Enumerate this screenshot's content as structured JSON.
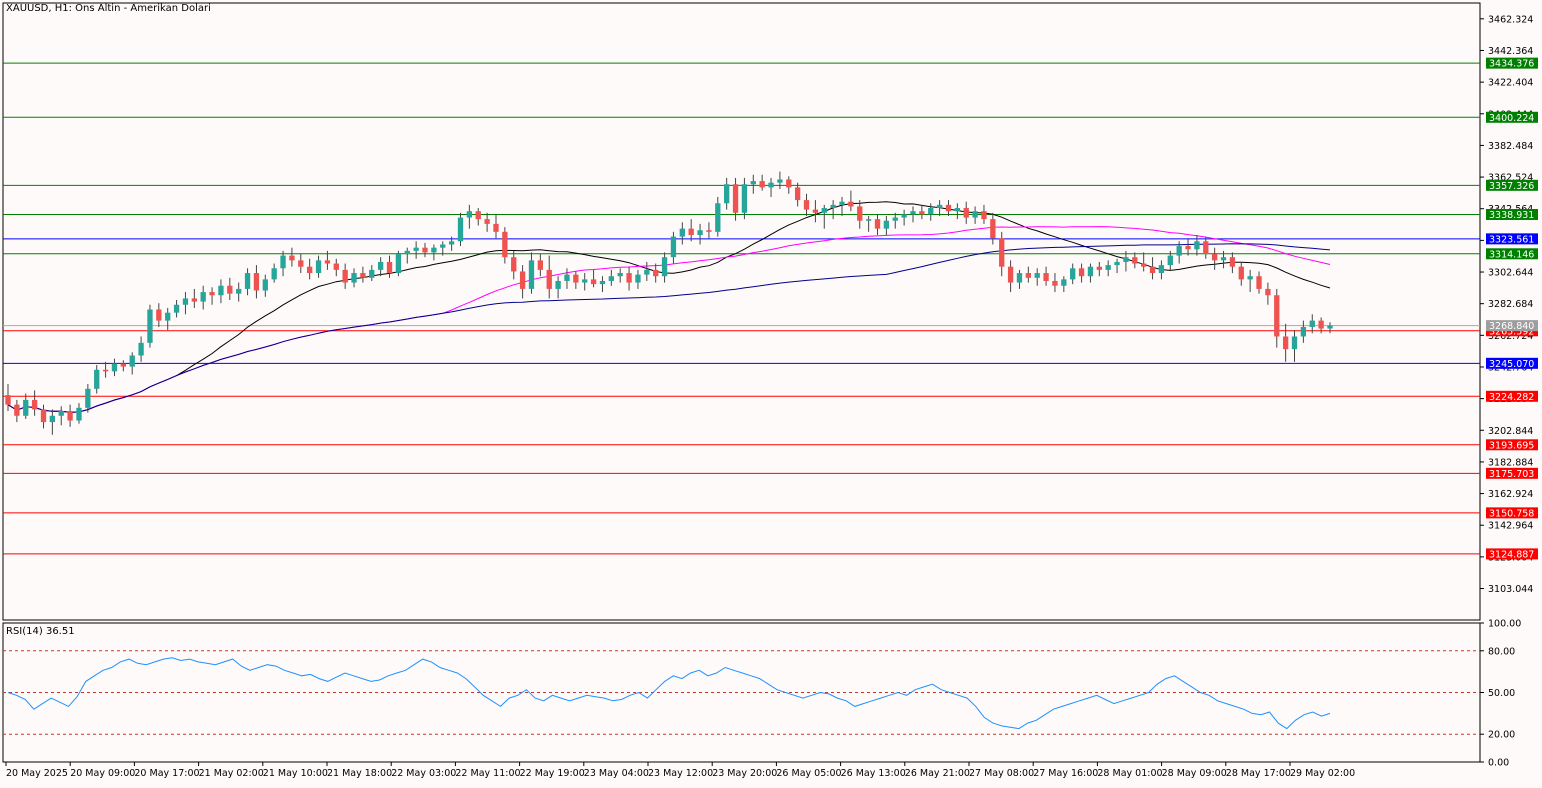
{
  "title": "XAUUSD, H1:  Ons Altin - Amerikan Dolari",
  "rsi_title": "RSI(14) 36.51",
  "chart_data": [
    {
      "type": "candlestick",
      "symbol": "XAUUSD",
      "timeframe": "H1",
      "title": "XAUUSD, H1:  Ons Altin - Amerikan Dolari",
      "ylim": [
        3083.2,
        3472.3
      ],
      "y_ticks": [
        "3462.324",
        "3442.364",
        "3422.404",
        "3402.444",
        "3382.484",
        "3362.524",
        "3342.564",
        "3322.604",
        "3302.644",
        "3282.684",
        "3262.724",
        "3242.764",
        "3222.804",
        "3202.844",
        "3182.884",
        "3162.924",
        "3142.964",
        "3123.004",
        "3103.044"
      ],
      "x_ticks": [
        "20 May 2025",
        "20 May 09:00",
        "20 May 17:00",
        "21 May 02:00",
        "21 May 10:00",
        "21 May 18:00",
        "22 May 03:00",
        "22 May 11:00",
        "22 May 19:00",
        "23 May 04:00",
        "23 May 12:00",
        "23 May 20:00",
        "26 May 05:00",
        "26 May 13:00",
        "26 May 21:00",
        "27 May 08:00",
        "27 May 16:00",
        "28 May 01:00",
        "28 May 09:00",
        "28 May 17:00",
        "29 May 02:00"
      ],
      "current_price": 3268.84,
      "current_price_label": "3268.840",
      "levels": [
        {
          "value": 3434.376,
          "label": "3434.376",
          "color": "#008000"
        },
        {
          "value": 3400.224,
          "label": "3400.224",
          "color": "#008000"
        },
        {
          "value": 3357.326,
          "label": "3357.326",
          "color": "#008000"
        },
        {
          "value": 3338.931,
          "label": "3338.931",
          "color": "#008000"
        },
        {
          "value": 3323.561,
          "label": "3323.561",
          "color": "#0000ff"
        },
        {
          "value": 3314.146,
          "label": "3314.146",
          "color": "#008000"
        },
        {
          "value": 3265.592,
          "label": "3265.592",
          "color": "#ff0000"
        },
        {
          "value": 3245.07,
          "label": "3245.070",
          "color": "#0000ff"
        },
        {
          "value": 3224.282,
          "label": "3224.282",
          "color": "#ff0000"
        },
        {
          "value": 3193.695,
          "label": "3193.695",
          "color": "#ff0000"
        },
        {
          "value": 3175.703,
          "label": "3175.703",
          "color": "#ff0000"
        },
        {
          "value": 3150.758,
          "label": "3150.758",
          "color": "#ff0000"
        },
        {
          "value": 3124.887,
          "label": "3124.887",
          "color": "#ff0000"
        }
      ],
      "colors": {
        "up": "#26a69a",
        "down": "#ef5350",
        "wick": "#444444",
        "background": "#fffafa"
      },
      "candles": [
        [
          3225,
          3232,
          3215,
          3219
        ],
        [
          3219,
          3222,
          3208,
          3212
        ],
        [
          3212,
          3226,
          3210,
          3222
        ],
        [
          3222,
          3228,
          3212,
          3216
        ],
        [
          3216,
          3219,
          3204,
          3208
        ],
        [
          3208,
          3216,
          3200,
          3212
        ],
        [
          3212,
          3218,
          3206,
          3215
        ],
        [
          3215,
          3219,
          3205,
          3209
        ],
        [
          3209,
          3220,
          3207,
          3217
        ],
        [
          3217,
          3232,
          3214,
          3229
        ],
        [
          3229,
          3244,
          3226,
          3241
        ],
        [
          3241,
          3246,
          3236,
          3240
        ],
        [
          3240,
          3248,
          3237,
          3245
        ],
        [
          3245,
          3247,
          3240,
          3243
        ],
        [
          3243,
          3252,
          3238,
          3250
        ],
        [
          3250,
          3262,
          3246,
          3258
        ],
        [
          3258,
          3282,
          3255,
          3279
        ],
        [
          3279,
          3283,
          3268,
          3272
        ],
        [
          3272,
          3280,
          3266,
          3277
        ],
        [
          3277,
          3285,
          3274,
          3282
        ],
        [
          3282,
          3290,
          3276,
          3286
        ],
        [
          3286,
          3292,
          3280,
          3284
        ],
        [
          3284,
          3294,
          3279,
          3290
        ],
        [
          3290,
          3293,
          3282,
          3288
        ],
        [
          3288,
          3298,
          3283,
          3294
        ],
        [
          3294,
          3299,
          3285,
          3289
        ],
        [
          3289,
          3296,
          3284,
          3292
        ],
        [
          3292,
          3305,
          3288,
          3302
        ],
        [
          3302,
          3307,
          3286,
          3291
        ],
        [
          3291,
          3301,
          3287,
          3298
        ],
        [
          3298,
          3308,
          3296,
          3305
        ],
        [
          3305,
          3316,
          3300,
          3313
        ],
        [
          3313,
          3318,
          3306,
          3310
        ],
        [
          3310,
          3314,
          3302,
          3306
        ],
        [
          3306,
          3311,
          3298,
          3302
        ],
        [
          3302,
          3313,
          3299,
          3310
        ],
        [
          3310,
          3316,
          3304,
          3308
        ],
        [
          3308,
          3311,
          3300,
          3304
        ],
        [
          3304,
          3308,
          3292,
          3296
        ],
        [
          3296,
          3305,
          3293,
          3302
        ],
        [
          3302,
          3306,
          3296,
          3299
        ],
        [
          3299,
          3307,
          3297,
          3304
        ],
        [
          3304,
          3312,
          3300,
          3309
        ],
        [
          3309,
          3313,
          3299,
          3302
        ],
        [
          3302,
          3316,
          3300,
          3314
        ],
        [
          3314,
          3318,
          3308,
          3316
        ],
        [
          3316,
          3322,
          3311,
          3318
        ],
        [
          3318,
          3321,
          3312,
          3315
        ],
        [
          3315,
          3320,
          3310,
          3318
        ],
        [
          3318,
          3322,
          3313,
          3320
        ],
        [
          3320,
          3325,
          3316,
          3322
        ],
        [
          3322,
          3340,
          3319,
          3337
        ],
        [
          3337,
          3345,
          3330,
          3341
        ],
        [
          3341,
          3343,
          3332,
          3336
        ],
        [
          3336,
          3340,
          3328,
          3333
        ],
        [
          3333,
          3339,
          3324,
          3328
        ],
        [
          3328,
          3331,
          3308,
          3312
        ],
        [
          3312,
          3316,
          3298,
          3303
        ],
        [
          3303,
          3307,
          3286,
          3292
        ],
        [
          3292,
          3315,
          3289,
          3310
        ],
        [
          3310,
          3314,
          3300,
          3304
        ],
        [
          3304,
          3313,
          3286,
          3292
        ],
        [
          3292,
          3300,
          3286,
          3297
        ],
        [
          3297,
          3305,
          3292,
          3301
        ],
        [
          3301,
          3303,
          3292,
          3296
        ],
        [
          3296,
          3302,
          3291,
          3298
        ],
        [
          3298,
          3304,
          3293,
          3295
        ],
        [
          3295,
          3300,
          3290,
          3297
        ],
        [
          3297,
          3304,
          3294,
          3300
        ],
        [
          3300,
          3305,
          3296,
          3302
        ],
        [
          3302,
          3306,
          3291,
          3296
        ],
        [
          3296,
          3304,
          3292,
          3301
        ],
        [
          3301,
          3309,
          3297,
          3304
        ],
        [
          3304,
          3308,
          3296,
          3300
        ],
        [
          3300,
          3315,
          3296,
          3312
        ],
        [
          3312,
          3328,
          3308,
          3325
        ],
        [
          3325,
          3334,
          3320,
          3330
        ],
        [
          3330,
          3336,
          3322,
          3326
        ],
        [
          3326,
          3333,
          3320,
          3329
        ],
        [
          3329,
          3334,
          3324,
          3328
        ],
        [
          3328,
          3350,
          3325,
          3346
        ],
        [
          3346,
          3362,
          3342,
          3358
        ],
        [
          3358,
          3362,
          3335,
          3340
        ],
        [
          3340,
          3362,
          3336,
          3358
        ],
        [
          3358,
          3364,
          3352,
          3360
        ],
        [
          3360,
          3364,
          3354,
          3356
        ],
        [
          3356,
          3362,
          3350,
          3359
        ],
        [
          3359,
          3366,
          3355,
          3361
        ],
        [
          3361,
          3363,
          3352,
          3356
        ],
        [
          3356,
          3359,
          3344,
          3348
        ],
        [
          3348,
          3352,
          3338,
          3342
        ],
        [
          3342,
          3348,
          3334,
          3340
        ],
        [
          3340,
          3345,
          3330,
          3343
        ],
        [
          3343,
          3348,
          3336,
          3345
        ],
        [
          3345,
          3350,
          3338,
          3347
        ],
        [
          3347,
          3354,
          3341,
          3344
        ],
        [
          3344,
          3348,
          3330,
          3335
        ],
        [
          3335,
          3338,
          3328,
          3336
        ],
        [
          3336,
          3339,
          3326,
          3330
        ],
        [
          3330,
          3338,
          3326,
          3335
        ],
        [
          3335,
          3340,
          3330,
          3337
        ],
        [
          3337,
          3342,
          3332,
          3339
        ],
        [
          3339,
          3344,
          3334,
          3341
        ],
        [
          3341,
          3345,
          3336,
          3339
        ],
        [
          3339,
          3346,
          3335,
          3343
        ],
        [
          3343,
          3348,
          3338,
          3345
        ],
        [
          3345,
          3348,
          3338,
          3341
        ],
        [
          3341,
          3346,
          3336,
          3343
        ],
        [
          3343,
          3347,
          3333,
          3337
        ],
        [
          3337,
          3344,
          3333,
          3341
        ],
        [
          3341,
          3345,
          3333,
          3336
        ],
        [
          3336,
          3340,
          3320,
          3324
        ],
        [
          3324,
          3328,
          3300,
          3306
        ],
        [
          3306,
          3310,
          3290,
          3296
        ],
        [
          3296,
          3304,
          3292,
          3302
        ],
        [
          3302,
          3306,
          3296,
          3299
        ],
        [
          3299,
          3305,
          3294,
          3302
        ],
        [
          3302,
          3306,
          3294,
          3297
        ],
        [
          3297,
          3302,
          3290,
          3294
        ],
        [
          3294,
          3300,
          3290,
          3298
        ],
        [
          3298,
          3308,
          3295,
          3305
        ],
        [
          3305,
          3308,
          3296,
          3300
        ],
        [
          3300,
          3308,
          3296,
          3306
        ],
        [
          3306,
          3309,
          3300,
          3304
        ],
        [
          3304,
          3310,
          3300,
          3307
        ],
        [
          3307,
          3311,
          3302,
          3309
        ],
        [
          3309,
          3316,
          3303,
          3312
        ],
        [
          3312,
          3315,
          3305,
          3308
        ],
        [
          3308,
          3315,
          3303,
          3306
        ],
        [
          3306,
          3312,
          3298,
          3302
        ],
        [
          3302,
          3310,
          3298,
          3307
        ],
        [
          3307,
          3316,
          3304,
          3313
        ],
        [
          3313,
          3322,
          3308,
          3319
        ],
        [
          3319,
          3324,
          3313,
          3317
        ],
        [
          3317,
          3326,
          3313,
          3322
        ],
        [
          3322,
          3325,
          3311,
          3314
        ],
        [
          3314,
          3318,
          3304,
          3310
        ],
        [
          3310,
          3316,
          3305,
          3312
        ],
        [
          3312,
          3315,
          3302,
          3306
        ],
        [
          3306,
          3309,
          3294,
          3298
        ],
        [
          3298,
          3304,
          3290,
          3300
        ],
        [
          3300,
          3303,
          3289,
          3292
        ],
        [
          3292,
          3296,
          3282,
          3288
        ],
        [
          3288,
          3292,
          3255,
          3262
        ],
        [
          3262,
          3270,
          3246,
          3254
        ],
        [
          3254,
          3266,
          3246,
          3262
        ],
        [
          3262,
          3272,
          3258,
          3268
        ],
        [
          3268,
          3276,
          3264,
          3272
        ],
        [
          3272,
          3274,
          3264,
          3267
        ],
        [
          3267,
          3271,
          3264,
          3269
        ]
      ],
      "moving_averages": [
        {
          "period": 20,
          "color": "#000000"
        },
        {
          "period": 50,
          "color": "#ff00ff"
        },
        {
          "period": 100,
          "color": "#00008b"
        }
      ]
    },
    {
      "type": "line",
      "title": "RSI(14) 36.51",
      "ylim": [
        0,
        100
      ],
      "y_ticks": [
        "100.00",
        "80.00",
        "50.00",
        "20.00",
        "0.00"
      ],
      "levels": [
        80,
        50,
        20
      ],
      "color": "#1e90ff",
      "values": [
        50,
        48,
        45,
        38,
        42,
        46,
        43,
        40,
        47,
        58,
        62,
        66,
        68,
        72,
        74,
        71,
        70,
        72,
        74,
        75,
        73,
        74,
        72,
        71,
        70,
        72,
        74,
        69,
        66,
        68,
        70,
        69,
        66,
        64,
        62,
        63,
        60,
        58,
        61,
        64,
        62,
        60,
        58,
        59,
        62,
        64,
        66,
        70,
        74,
        72,
        68,
        66,
        64,
        60,
        54,
        48,
        44,
        40,
        46,
        48,
        52,
        46,
        44,
        48,
        46,
        44,
        46,
        48,
        47,
        46,
        44,
        45,
        48,
        50,
        46,
        52,
        58,
        62,
        60,
        64,
        66,
        62,
        64,
        68,
        66,
        64,
        62,
        60,
        56,
        52,
        50,
        48,
        46,
        48,
        50,
        49,
        46,
        44,
        40,
        42,
        44,
        46,
        48,
        50,
        48,
        52,
        54,
        56,
        52,
        50,
        48,
        46,
        40,
        32,
        28,
        26,
        25,
        24,
        28,
        30,
        34,
        38,
        40,
        42,
        44,
        46,
        48,
        45,
        42,
        44,
        46,
        48,
        50,
        56,
        60,
        62,
        58,
        54,
        50,
        48,
        44,
        42,
        40,
        38,
        35,
        34,
        36,
        28,
        24,
        30,
        34,
        36,
        33,
        35
      ]
    }
  ]
}
